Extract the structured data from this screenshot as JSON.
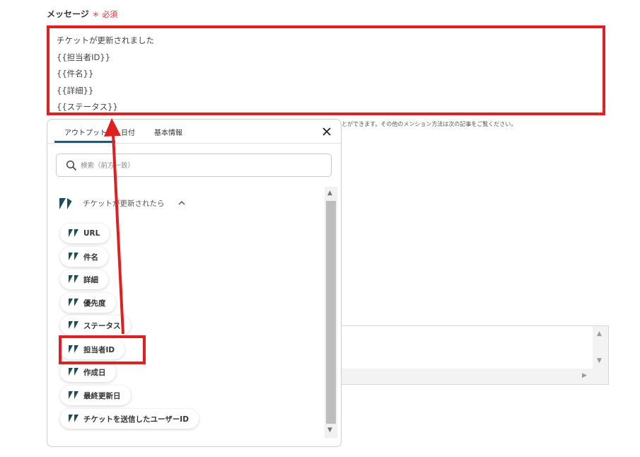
{
  "field": {
    "label": "メッセージ",
    "required_mark": "＊",
    "required_text": "必須"
  },
  "message": {
    "lines": [
      "チケットが更新されました",
      "{{担当者ID}}",
      "{{件名}}",
      "{{詳細}}",
      "{{ステータス}}"
    ]
  },
  "hint": {
    "text": "とができます。その他のメンション方法は次の記事をご覧ください。"
  },
  "popup": {
    "tabs": [
      {
        "label": "アウトプット",
        "active": true
      },
      {
        "label": "日付",
        "active": false
      },
      {
        "label": "基本情報",
        "active": false
      }
    ],
    "close_icon": "close-icon",
    "search": {
      "value": "",
      "placeholder": "検索（前方一致）",
      "icon": "search-icon"
    },
    "group": {
      "title": "チケットが更新されたら",
      "icon": "zendesk-logo-icon",
      "expanded": true
    },
    "items": [
      {
        "label": "URL"
      },
      {
        "label": "件名"
      },
      {
        "label": "詳細"
      },
      {
        "label": "優先度"
      },
      {
        "label": "ステータス"
      },
      {
        "label": "担当者ID",
        "highlighted": true
      },
      {
        "label": "作成日"
      },
      {
        "label": "最終更新日"
      },
      {
        "label": "チケットを送信したユーザーID"
      }
    ]
  },
  "colors": {
    "highlight": "#e02020",
    "accent": "#1a5f73",
    "required": "#e0333a",
    "zendesk": "#1f4e5a"
  }
}
